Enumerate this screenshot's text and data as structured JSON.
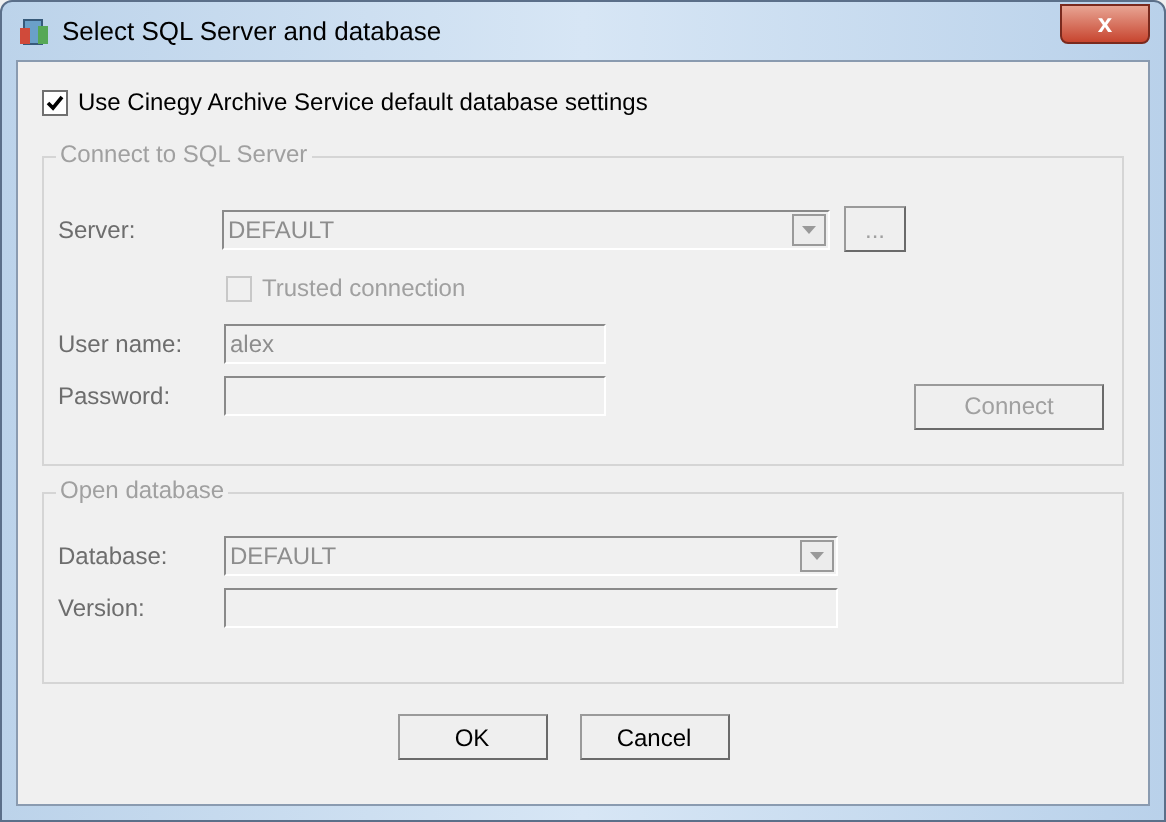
{
  "window": {
    "title": "Select SQL Server and database",
    "close": "x"
  },
  "use_defaults": {
    "label": "Use Cinegy Archive Service default database settings",
    "checked": true
  },
  "connect_group": {
    "title": "Connect to SQL Server",
    "disabled": true,
    "server": {
      "label": "Server:",
      "value": "DEFAULT",
      "browse": "..."
    },
    "trusted": {
      "label": "Trusted connection",
      "checked": false
    },
    "user": {
      "label": "User name:",
      "value": "alex"
    },
    "password": {
      "label": "Password:"
    },
    "connect": "Connect"
  },
  "database_group": {
    "title": "Open database",
    "disabled": true,
    "database": {
      "label": "Database:",
      "value": "DEFAULT"
    },
    "version": {
      "label": "Version:"
    }
  },
  "buttons": [
    "OK",
    "Cancel"
  ]
}
